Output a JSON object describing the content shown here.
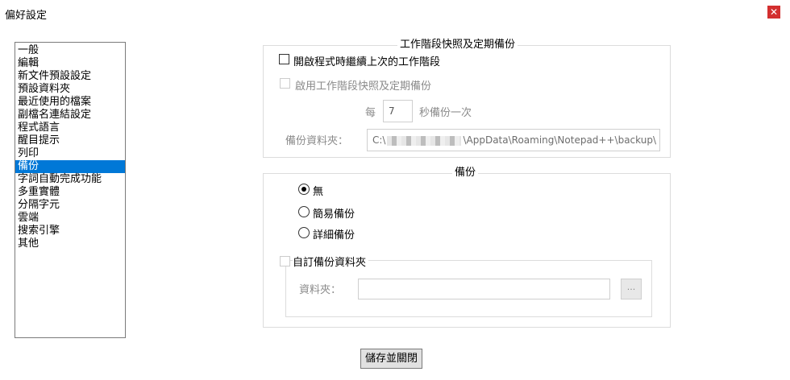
{
  "window": {
    "title": "偏好設定",
    "close_glyph": "✕"
  },
  "sidebar": {
    "items": [
      {
        "label": "一般"
      },
      {
        "label": "編輯"
      },
      {
        "label": "新文件預設設定"
      },
      {
        "label": "預設資料夾"
      },
      {
        "label": "最近使用的檔案"
      },
      {
        "label": "副檔名連結設定"
      },
      {
        "label": "程式語言"
      },
      {
        "label": "醒目提示"
      },
      {
        "label": "列印"
      },
      {
        "label": "備份",
        "selected": true
      },
      {
        "label": "字詞自動完成功能"
      },
      {
        "label": "多重實體"
      },
      {
        "label": "分隔字元"
      },
      {
        "label": "雲端"
      },
      {
        "label": "搜索引擎"
      },
      {
        "label": "其他"
      }
    ]
  },
  "session_group": {
    "title": "工作階段快照及定期備份",
    "remember_session_label": "開啟程式時繼續上次的工作階段",
    "remember_session_checked": false,
    "enable_snapshot_label": "啟用工作階段快照及定期備份",
    "enable_snapshot_checked": false,
    "every_label": "每",
    "interval_value": "7",
    "interval_suffix": "秒備份一次",
    "backup_path_label": "備份資料夾：",
    "backup_path_prefix": "C:\\",
    "backup_path_suffix": "\\AppData\\Roaming\\Notepad++\\backup\\"
  },
  "backup_group": {
    "title": "備份",
    "options": [
      "無",
      "簡易備份",
      "詳細備份"
    ],
    "selected": "無",
    "custom_dir_label": "自訂備份資料夾",
    "custom_dir_checked": false,
    "folder_label": "資料夾：",
    "folder_value": "",
    "browse_label": "..."
  },
  "footer": {
    "save_close_label": "儲存並關閉"
  }
}
